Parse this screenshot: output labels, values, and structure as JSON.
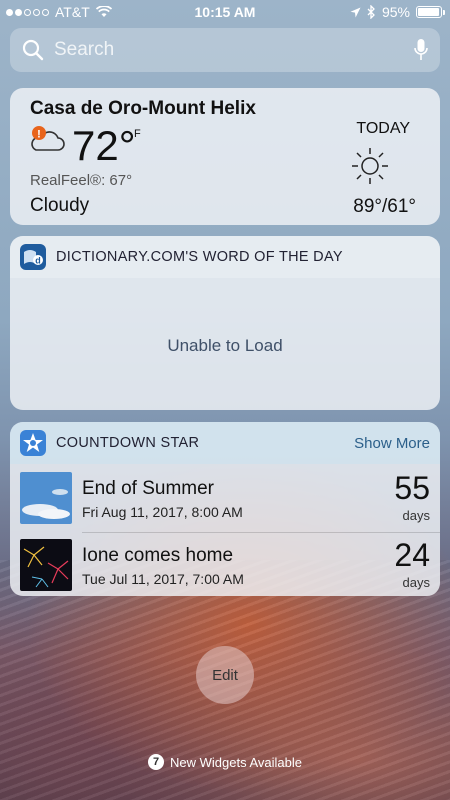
{
  "status_bar": {
    "carrier": "AT&T",
    "time": "10:15 AM",
    "battery": "95%",
    "battery_level": 0.95,
    "signal_bars": 2
  },
  "search": {
    "placeholder": "Search"
  },
  "weather": {
    "location": "Casa de Oro-Mount Helix",
    "temperature": "72°",
    "unit": "F",
    "realfeel": "RealFeel®: 67°",
    "condition": "Cloudy",
    "today_label": "TODAY",
    "high_low": "89°/61°"
  },
  "dictionary": {
    "title": "DICTIONARY.COM'S WORD OF THE DAY",
    "message": "Unable to Load"
  },
  "countdown": {
    "title": "COUNTDOWN STAR",
    "show_more": "Show More",
    "items": [
      {
        "name": "End of Summer",
        "date": "Fri Aug 11, 2017, 8:00 AM",
        "count": "55",
        "unit": "days"
      },
      {
        "name": "Ione comes home",
        "date": "Tue Jul 11, 2017, 7:00 AM",
        "count": "24",
        "unit": "days"
      }
    ]
  },
  "edit_label": "Edit",
  "footer": {
    "badge": "7",
    "text": "New Widgets Available"
  }
}
